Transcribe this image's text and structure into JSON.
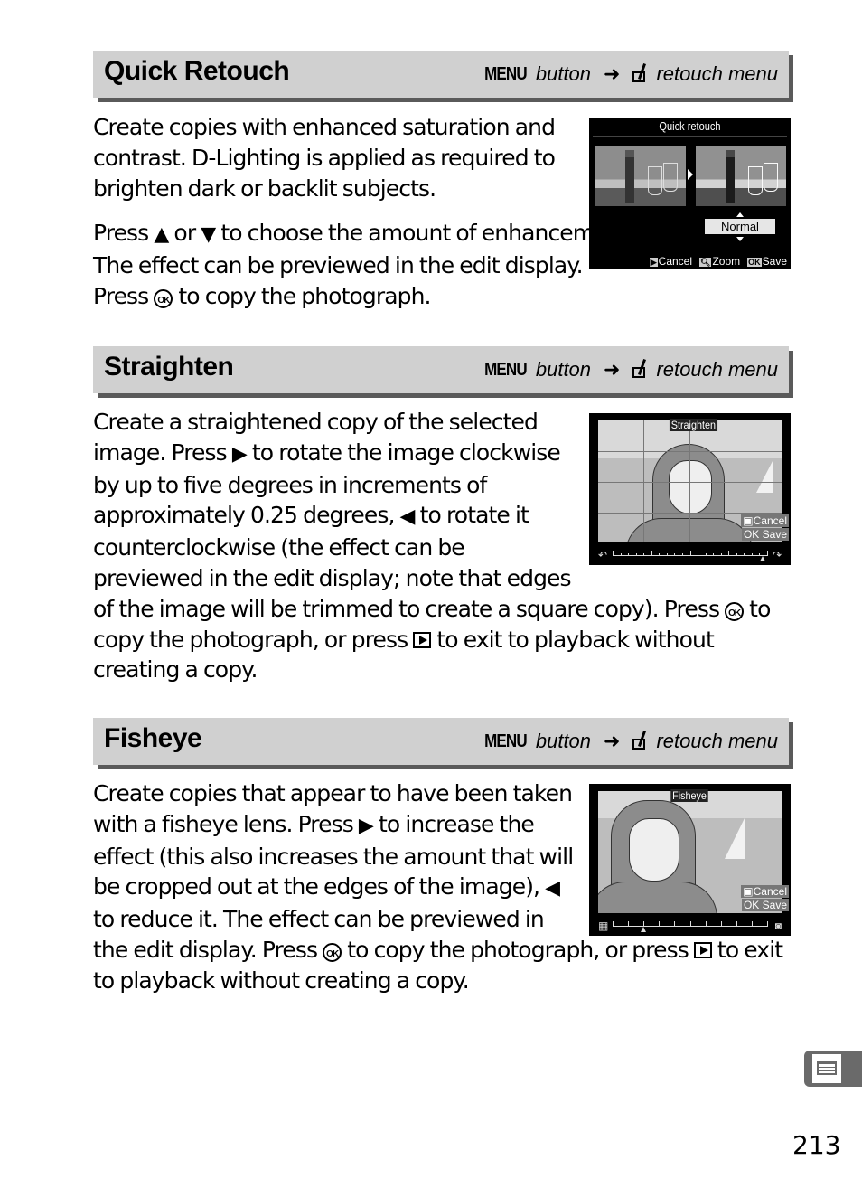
{
  "sections": [
    {
      "title": "Quick Retouch",
      "path": {
        "menu": "MENU",
        "button": "button",
        "arrow": "➜",
        "target": "retouch menu"
      },
      "paragraphs": [
        "Create copies with enhanced saturation and contrast.  D-Lighting is applied as required to brighten dark or backlit subjects."
      ],
      "p2": {
        "a": "Press ",
        "up": "▲",
        "b": " or ",
        "down": "▼",
        "c": " to choose the amount of enhancement.  The effect can be previewed in the edit display.  Press ",
        "d": " to copy the photograph."
      },
      "screen": {
        "title": "Quick retouch",
        "value": "Normal",
        "footer": {
          "cancel": "Cancel",
          "zoom": "Zoom",
          "ok": "OK",
          "save": "Save"
        }
      }
    },
    {
      "title": "Straighten",
      "path": {
        "menu": "MENU",
        "button": "button",
        "arrow": "➜",
        "target": "retouch menu"
      },
      "text": {
        "a": "Create a straightened copy of the selected image.  Press ",
        "right": "▶",
        "b": " to rotate the image clockwise by up to five degrees in increments of approximately 0.25 degrees, ",
        "left": "◀",
        "c": " to rotate it counterclockwise (the effect can be previewed in the edit display; note that edges of the image will be trimmed to create a square copy).  Press ",
        "d": " to copy the photograph, or press ",
        "e": " to exit to playback without creating a copy."
      },
      "screen": {
        "title": "Straighten",
        "cancel": "Cancel",
        "ok": "OK",
        "save": "Save",
        "slider_position": 0.97
      }
    },
    {
      "title": "Fisheye",
      "path": {
        "menu": "MENU",
        "button": "button",
        "arrow": "➜",
        "target": "retouch menu"
      },
      "text": {
        "a": "Create copies that appear to have been taken with a fisheye lens.  Press ",
        "right": "▶",
        "b": " to increase the effect (this also increases the amount that will be cropped out at the edges of the image), ",
        "left": "◀",
        "c": " to reduce it.  The effect can be previewed in the edit display.  Press ",
        "d": " to copy the photograph, or press ",
        "e": " to exit to playback without creating a copy."
      },
      "screen": {
        "title": "Fisheye",
        "cancel": "Cancel",
        "ok": "OK",
        "save": "Save",
        "slider_position": 0.2
      }
    }
  ],
  "ok_glyph": "OK",
  "side_tab": {
    "icon": "menu-list-icon"
  },
  "page_number": "213"
}
